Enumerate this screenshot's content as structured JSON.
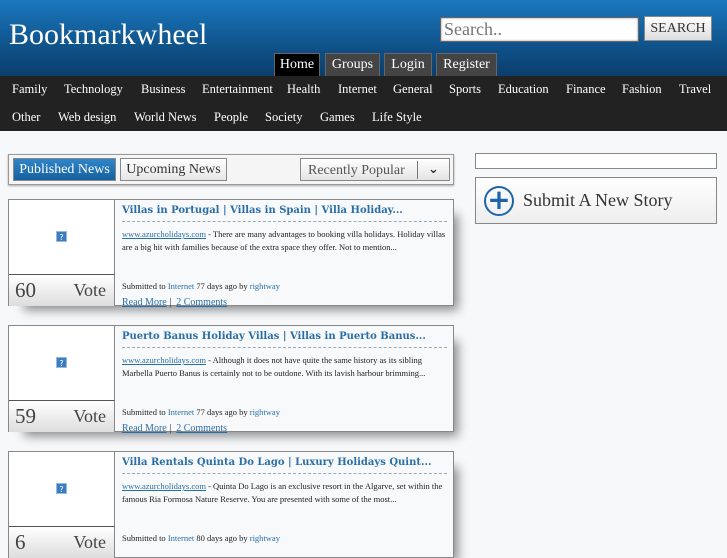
{
  "header": {
    "logo": "Bookmarkwheel",
    "search_placeholder": "Search..",
    "search_button": "SEARCH",
    "nav": [
      "Home",
      "Groups",
      "Login",
      "Register"
    ]
  },
  "categories": {
    "row1": [
      "Family",
      "Technology",
      "Business",
      "Entertainment",
      "Health",
      "Internet",
      "General",
      "Sports",
      "Education",
      "Finance",
      "Fashion",
      "Travel"
    ],
    "row2": [
      "Other",
      "Web design",
      "World News",
      "People",
      "Society",
      "Games",
      "Life Style"
    ]
  },
  "tabs": {
    "published": "Published News",
    "upcoming": "Upcoming News",
    "sort": "Recently Popular"
  },
  "vote_label": "Vote",
  "read_more": "Read More",
  "separator": "|",
  "stories": [
    {
      "title": "Villas in Portugal | Villas in Spain | Villa Holiday...",
      "domain": "www.azurcholidays.com",
      "desc": " - There are many advantages to booking villa holidays. Holiday villas are a big hit with families because of the extra space they offer. Not to mention...",
      "submitted": "Submitted to ",
      "category": "Internet",
      "age": " 77 days ago by ",
      "user": "rightway",
      "votes": "60",
      "comments": "2 Comments"
    },
    {
      "title": "Puerto Banus Holiday Villas | Villas in Puerto Banus...",
      "domain": "www.azurcholidays.com",
      "desc": " - Although it does not have quite the same history as its sibling Marbella Puerto Banus is certainly not to be outdone. With its lavish harbour brimming...",
      "submitted": "Submitted to ",
      "category": "Internet",
      "age": " 77 days ago by ",
      "user": "rightway",
      "votes": "59",
      "comments": "2 Comments"
    },
    {
      "title": "Villa Rentals Quinta Do Lago | Luxury Holidays Quint...",
      "domain": "www.azurcholidays.com",
      "desc": " - Quinta Do Lago is an exclusive resort in the Algarve, set within the famous Ria Formosa Nature Reserve. You are presented with some of the most...",
      "submitted": "Submitted to ",
      "category": "Internet",
      "age": " 80 days ago by ",
      "user": "rightway",
      "votes": "6",
      "comments": ""
    }
  ],
  "sidebar": {
    "submit": "Submit A New Story"
  }
}
